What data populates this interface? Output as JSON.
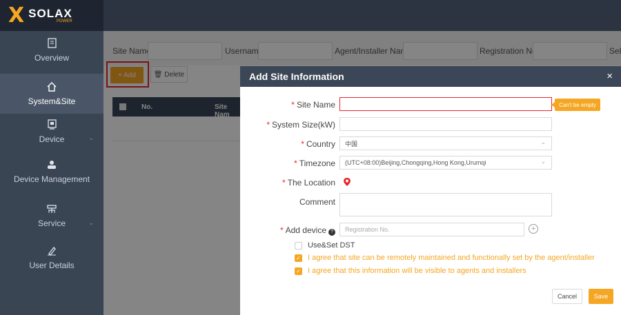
{
  "brand": {
    "logo_word": "SOLAX",
    "logo_sub": "POWER",
    "accent": "#f5a623",
    "dark": "#3b4656"
  },
  "sidebar": {
    "items": [
      {
        "label": "Overview",
        "icon": "overview-icon"
      },
      {
        "label": "System&Site",
        "icon": "home-icon",
        "active": true
      },
      {
        "label": "Device",
        "icon": "device-icon"
      },
      {
        "label": "Device Management",
        "icon": "user-group-icon"
      },
      {
        "label": "Service",
        "icon": "service-icon"
      },
      {
        "label": "User Details",
        "icon": "pencil-icon"
      }
    ]
  },
  "filters": {
    "site_name": "Site Name",
    "username": "Username",
    "agent": "Agent/Installer Name",
    "registration": "Registration No.",
    "select": "Sele"
  },
  "toolbar": {
    "add_label": "+ Add",
    "delete_label": "Delete"
  },
  "table": {
    "col_no": "No.",
    "col_site": "Site Nam"
  },
  "dialog": {
    "title": "Add Site Information",
    "close": "×",
    "site_name_label": "Site Name",
    "site_name_error": "Can't be empty",
    "system_size_label": "System Size(kW)",
    "country_label": "Country",
    "country_value": "中国",
    "timezone_label": "Timezone",
    "timezone_value": "(UTC+08:00)Beijing,Chongqing,Hong Kong,Urumqi",
    "location_label": "The Location",
    "comment_label": "Comment",
    "add_device_label": "Add device",
    "add_device_placeholder": "Registration No.",
    "dst_label": "Use&Set DST",
    "agree1": "I agree that site can be remotely maintained and functionally set by the agent/installer",
    "agree2": "I agree that this information will be visible to agents and installers",
    "cancel": "Cancel",
    "save": "Save"
  }
}
